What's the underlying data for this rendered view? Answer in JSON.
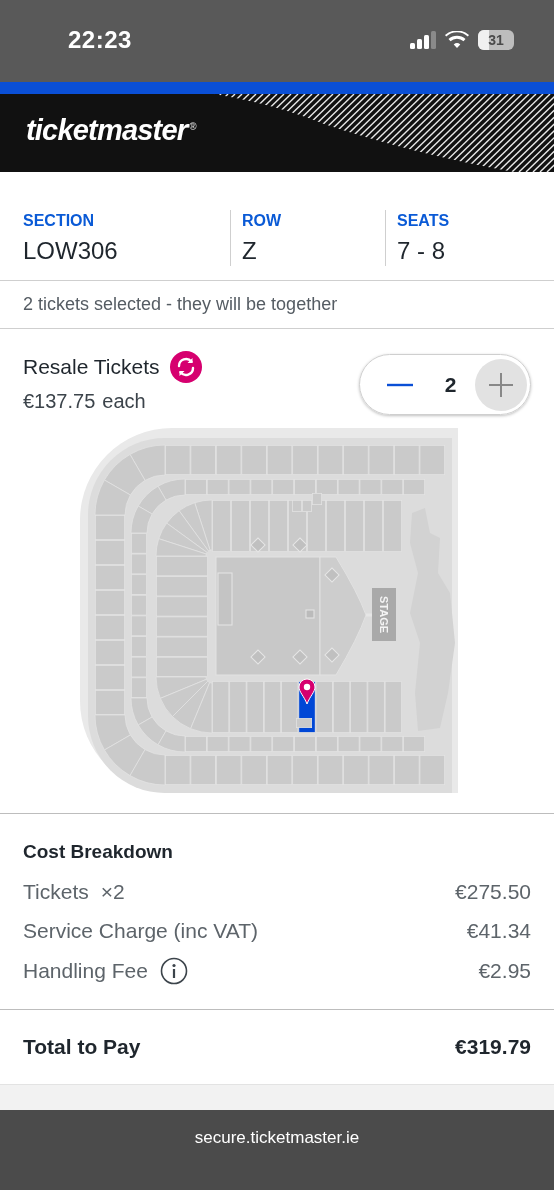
{
  "status_bar": {
    "time": "22:23",
    "battery": "31"
  },
  "header": {
    "logo": "ticketmaster",
    "logo_mark": "®"
  },
  "seat_info": [
    {
      "label": "SECTION",
      "value": "LOW306"
    },
    {
      "label": "ROW",
      "value": "Z"
    },
    {
      "label": "SEATS",
      "value": "7 - 8"
    }
  ],
  "selection_note": "2 tickets selected - they will be together",
  "offer": {
    "title": "Resale Tickets",
    "price": "€137.75",
    "price_unit": "each",
    "quantity": "2"
  },
  "seat_map": {
    "stage": "STAGE"
  },
  "cost_breakdown": {
    "title": "Cost Breakdown",
    "rows": [
      {
        "label": "Tickets",
        "qty": "×2",
        "amount": "€275.50"
      },
      {
        "label": "Service Charge (inc VAT)",
        "amount": "€41.34"
      },
      {
        "label": "Handling Fee",
        "amount": "€2.95",
        "info": true
      }
    ]
  },
  "total": {
    "label": "Total to Pay",
    "amount": "€319.79"
  },
  "url_bar": {
    "url": "secure.ticketmaster.ie"
  }
}
